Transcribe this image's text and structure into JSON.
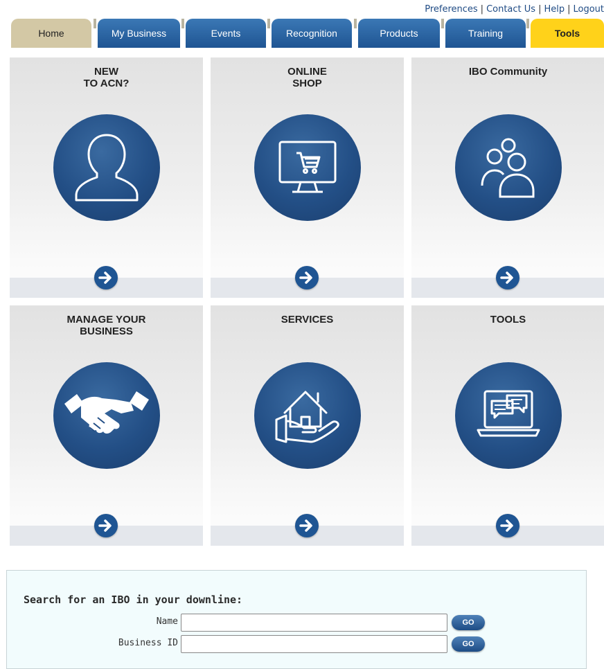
{
  "util_links": [
    "Preferences",
    "Contact Us",
    "Help",
    "Logout"
  ],
  "tabs": [
    "Home",
    "My Business",
    "Events",
    "Recognition",
    "Products",
    "Training",
    "Tools"
  ],
  "tiles": [
    {
      "title_line1": "NEW",
      "title_line2": "TO ACN?",
      "icon": "user-silhouette-icon"
    },
    {
      "title_line1": "ONLINE",
      "title_line2": "SHOP",
      "icon": "monitor-cart-icon"
    },
    {
      "title_line1": "IBO Community",
      "title_line2": "",
      "icon": "community-people-icon"
    },
    {
      "title_line1": "MANAGE YOUR",
      "title_line2": "BUSINESS",
      "icon": "handshake-icon"
    },
    {
      "title_line1": "SERVICES",
      "title_line2": "",
      "icon": "house-in-hand-icon"
    },
    {
      "title_line1": "TOOLS",
      "title_line2": "",
      "icon": "laptop-chat-icon"
    }
  ],
  "search": {
    "heading": "Search for an IBO in your downline:",
    "name_label": "Name",
    "business_id_label": "Business ID",
    "go_label": "GO",
    "name_value": "",
    "business_id_value": ""
  },
  "colors": {
    "tab_blue": "#1f5593",
    "home_tab": "#d3c8a5",
    "tools_tab": "#ffd21a",
    "icon_circle": "#234f86"
  }
}
